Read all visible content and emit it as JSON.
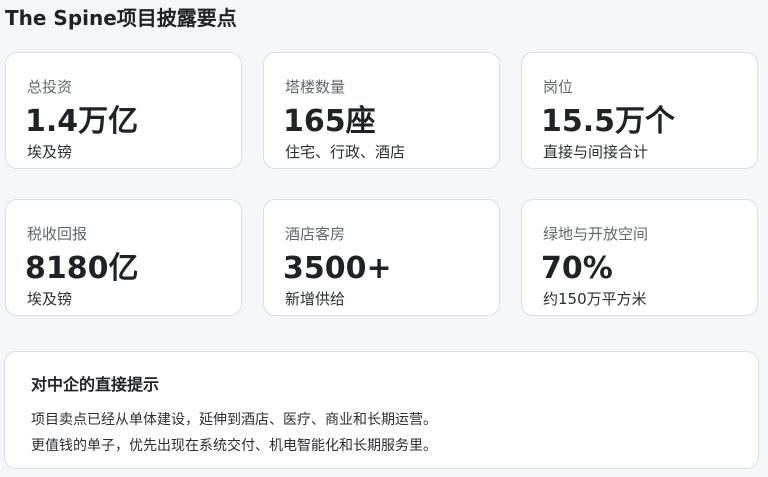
{
  "page": {
    "title": "The Spine项目披露要点"
  },
  "stats": [
    {
      "label": "总投资",
      "value": "1.4万亿",
      "sub": "埃及镑"
    },
    {
      "label": "塔楼数量",
      "value": "165座",
      "sub": "住宅、行政、酒店"
    },
    {
      "label": "岗位",
      "value": "15.5万个",
      "sub": "直接与间接合计"
    },
    {
      "label": "税收回报",
      "value": "8180亿",
      "sub": "埃及镑"
    },
    {
      "label": "酒店客房",
      "value": "3500+",
      "sub": "新增供给"
    },
    {
      "label": "绿地与开放空间",
      "value": "70%",
      "sub": "约150万平方米"
    }
  ],
  "note": {
    "title": "对中企的直接提示",
    "lines": [
      "项目卖点已经从单体建设，延伸到酒店、医疗、商业和长期运营。",
      "更值钱的单子，优先出现在系统交付、机电智能化和长期服务里。"
    ]
  }
}
